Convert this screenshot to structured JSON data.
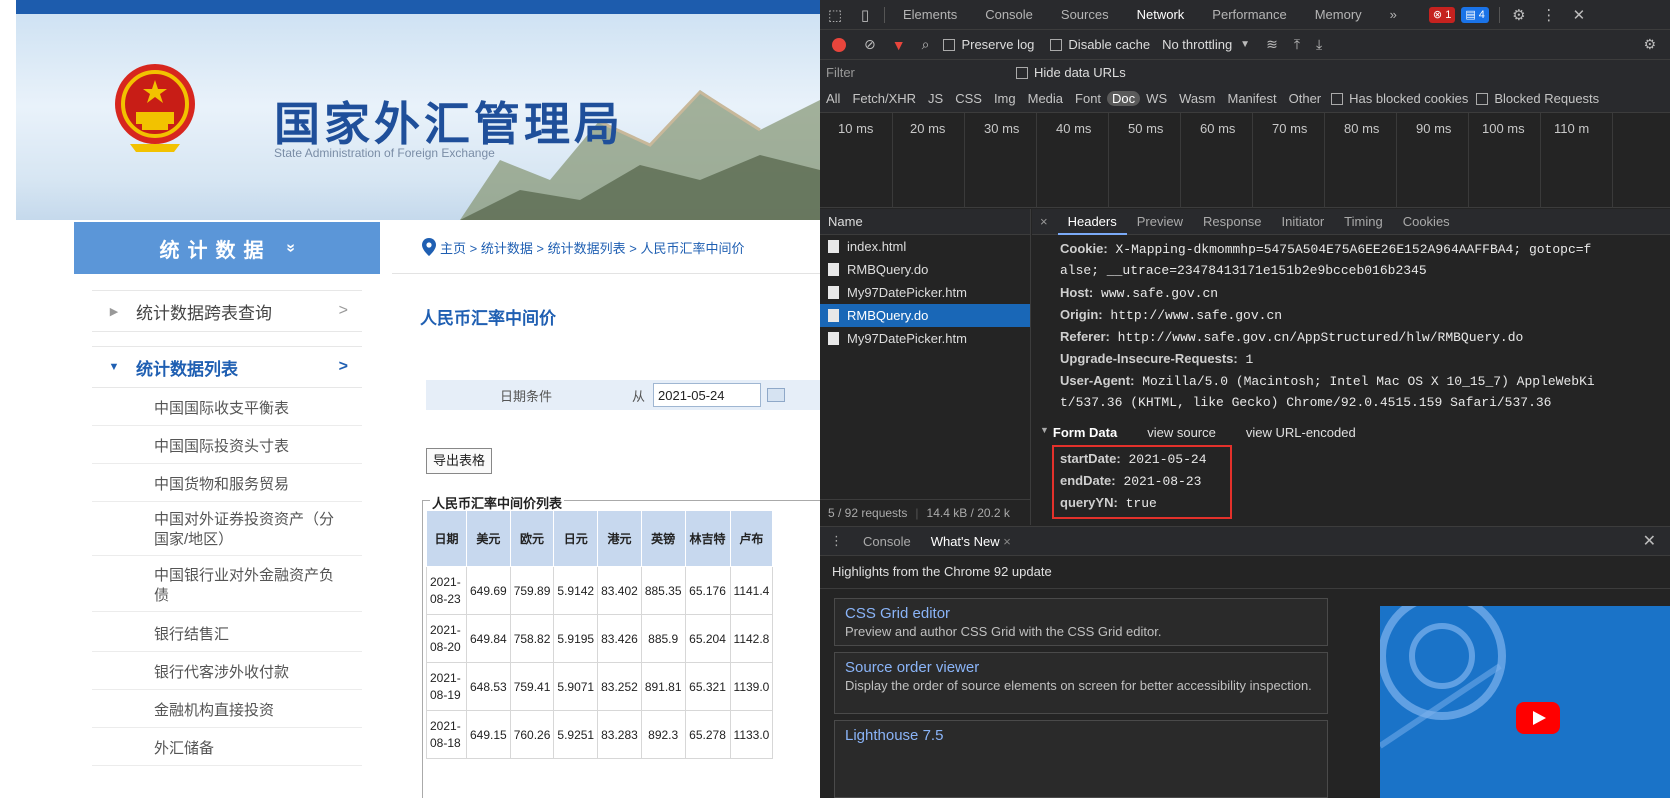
{
  "site": {
    "title": "国家外汇管理局",
    "subtitle": "State Administration of Foreign Exchange",
    "sidebar_header": "统计数据",
    "sidebar_header_chevron": "»",
    "nav_items": [
      {
        "label": "统计数据跨表查询"
      },
      {
        "label": "统计数据列表"
      }
    ],
    "sub_items": [
      "中国国际收支平衡表",
      "中国国际投资头寸表",
      "中国货物和服务贸易",
      "中国对外证券投资资产（分国家/地区）",
      "中国银行业对外金融资产负债",
      "银行结售汇",
      "银行代客涉外收付款",
      "金融机构直接投资",
      "外汇储备"
    ],
    "breadcrumb": "主页 > 统计数据 > 统计数据列表 > 人民币汇率中间价",
    "page_title": "人民币汇率中间价",
    "date_label": "日期条件",
    "from_label": "从",
    "start_date": "2021-05-24",
    "export_label": "导出表格",
    "table_title": "人民币汇率中间价列表",
    "table_headers": [
      "日期",
      "美元",
      "欧元",
      "日元",
      "港元",
      "英镑",
      "林吉特",
      "卢布"
    ],
    "rows": [
      {
        "date_a": "2021-",
        "date_b": "08-23",
        "cells": [
          "649.69",
          "759.89",
          "5.9142",
          "83.402",
          "885.35",
          "65.176",
          "1141.4"
        ]
      },
      {
        "date_a": "2021-",
        "date_b": "08-20",
        "cells": [
          "649.84",
          "758.82",
          "5.9195",
          "83.426",
          "885.9",
          "65.204",
          "1142.8"
        ]
      },
      {
        "date_a": "2021-",
        "date_b": "08-19",
        "cells": [
          "648.53",
          "759.41",
          "5.9071",
          "83.252",
          "891.81",
          "65.321",
          "1139.0"
        ]
      },
      {
        "date_a": "2021-",
        "date_b": "08-18",
        "cells": [
          "649.15",
          "760.26",
          "5.9251",
          "83.283",
          "892.3",
          "65.278",
          "1133.0"
        ]
      }
    ]
  },
  "devtools": {
    "tabs": [
      "Elements",
      "Console",
      "Sources",
      "Network",
      "Performance",
      "Memory",
      "»"
    ],
    "error_count": "1",
    "info_count": "4",
    "preserve_log": "Preserve log",
    "disable_cache": "Disable cache",
    "throttling": "No throttling",
    "filter_placeholder": "Filter",
    "hide_data_urls": "Hide data URLs",
    "types": [
      "All",
      "Fetch/XHR",
      "JS",
      "CSS",
      "Img",
      "Media",
      "Font",
      "Doc",
      "WS",
      "Wasm",
      "Manifest",
      "Other"
    ],
    "has_blocked_cookies": "Has blocked cookies",
    "blocked_requests": "Blocked Requests",
    "timeline_ticks": [
      "10 ms",
      "20 ms",
      "30 ms",
      "40 ms",
      "50 ms",
      "60 ms",
      "70 ms",
      "80 ms",
      "90 ms",
      "100 ms",
      "110 m"
    ],
    "name_header": "Name",
    "requests": [
      {
        "name": "index.html"
      },
      {
        "name": "RMBQuery.do"
      },
      {
        "name": "My97DatePicker.htm"
      },
      {
        "name": "RMBQuery.do"
      },
      {
        "name": "My97DatePicker.htm"
      }
    ],
    "footer_requests": "5 / 92 requests",
    "footer_size": "14.4 kB / 20.2 k",
    "detail_tabs": [
      "Headers",
      "Preview",
      "Response",
      "Initiator",
      "Timing",
      "Cookies"
    ],
    "headers": [
      {
        "key": "Cookie:",
        "value": "X-Mapping-dkmommhp=5475A504E75A6EE26E152A964AAFFBA4; gotopc=f"
      },
      {
        "key": "",
        "value": "alse; __utrace=23478413171e151b2e9bcceb016b2345"
      },
      {
        "key": "Host:",
        "value": "www.safe.gov.cn"
      },
      {
        "key": "Origin:",
        "value": "http://www.safe.gov.cn"
      },
      {
        "key": "Referer:",
        "value": "http://www.safe.gov.cn/AppStructured/hlw/RMBQuery.do"
      },
      {
        "key": "Upgrade-Insecure-Requests:",
        "value": "1"
      },
      {
        "key": "User-Agent:",
        "value": "Mozilla/5.0 (Macintosh; Intel Mac OS X 10_15_7) AppleWebKi"
      },
      {
        "key": "",
        "value": "t/537.36 (KHTML, like Gecko) Chrome/92.0.4515.159 Safari/537.36"
      }
    ],
    "form_data_label": "Form Data",
    "view_source": "view source",
    "view_url_encoded": "view URL-encoded",
    "form_data": [
      {
        "key": "startDate:",
        "value": "2021-05-24"
      },
      {
        "key": "endDate:",
        "value": "2021-08-23"
      },
      {
        "key": "queryYN:",
        "value": "true"
      }
    ],
    "drawer_tabs": [
      "Console",
      "What's New"
    ],
    "whats_new_heading": "Highlights from the Chrome 92 update",
    "cards": [
      {
        "title": "CSS Grid editor",
        "desc": "Preview and author CSS Grid with the CSS Grid editor."
      },
      {
        "title": "Source order viewer",
        "desc": "Display the order of source elements on screen for better accessibility inspection."
      },
      {
        "title": "Lighthouse 7.5",
        "desc": ""
      }
    ],
    "colors": {
      "error": "#c5221f",
      "info": "#1a73e8",
      "selection": "#1967b7",
      "highlight_box": "#e4312b"
    }
  }
}
